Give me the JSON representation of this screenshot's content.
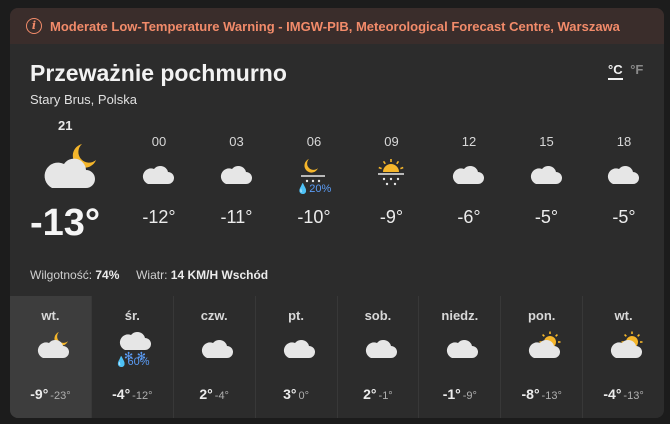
{
  "warning": {
    "text": "Moderate Low-Temperature Warning - IMGW-PIB, Meteorological Forecast Centre, Warszawa",
    "icon": "info-icon"
  },
  "current": {
    "condition": "Przeważnie pochmurno",
    "location": "Stary Brus, Polska",
    "hour": "21",
    "icon": "moon-cloud-icon",
    "temp": "-13°",
    "humidity_label": "Wilgotność:",
    "humidity": "74%",
    "wind_label": "Wiatr:",
    "wind": "14 KM/H Wschód"
  },
  "units": {
    "celsius": "°C",
    "fahrenheit": "°F",
    "selected": "°C"
  },
  "hourly": [
    {
      "hour": "00",
      "icon": "cloud-icon",
      "precip": "",
      "temp": "-12°"
    },
    {
      "hour": "03",
      "icon": "cloud-icon",
      "precip": "",
      "temp": "-11°"
    },
    {
      "hour": "06",
      "icon": "moon-snow-icon",
      "precip": "20%",
      "temp": "-10°"
    },
    {
      "hour": "09",
      "icon": "sun-snow-icon",
      "precip": "",
      "temp": "-9°"
    },
    {
      "hour": "12",
      "icon": "cloud-icon",
      "precip": "",
      "temp": "-6°"
    },
    {
      "hour": "15",
      "icon": "cloud-icon",
      "precip": "",
      "temp": "-5°"
    },
    {
      "hour": "18",
      "icon": "cloud-icon",
      "precip": "",
      "temp": "-5°"
    }
  ],
  "daily": [
    {
      "day": "wt.",
      "icon": "moon-cloud-icon",
      "precip": "",
      "hi": "-9°",
      "lo": "-23°",
      "active": true
    },
    {
      "day": "śr.",
      "icon": "cloud-snow-icon",
      "precip": "60%",
      "hi": "-4°",
      "lo": "-12°"
    },
    {
      "day": "czw.",
      "icon": "cloud-icon",
      "precip": "",
      "hi": "2°",
      "lo": "-4°"
    },
    {
      "day": "pt.",
      "icon": "cloud-icon",
      "precip": "",
      "hi": "3°",
      "lo": "0°"
    },
    {
      "day": "sob.",
      "icon": "cloud-icon",
      "precip": "",
      "hi": "2°",
      "lo": "-1°"
    },
    {
      "day": "niedz.",
      "icon": "cloud-icon",
      "precip": "",
      "hi": "-1°",
      "lo": "-9°"
    },
    {
      "day": "pon.",
      "icon": "sun-cloud-icon",
      "precip": "",
      "hi": "-8°",
      "lo": "-13°"
    },
    {
      "day": "wt.",
      "icon": "sun-cloud-icon",
      "precip": "",
      "hi": "-4°",
      "lo": "-13°"
    }
  ],
  "colors": {
    "warning_text": "#f28b6a",
    "warning_bg": "#3a2d2b",
    "sun": "#f5b62b",
    "precip": "#5b9cf5"
  }
}
